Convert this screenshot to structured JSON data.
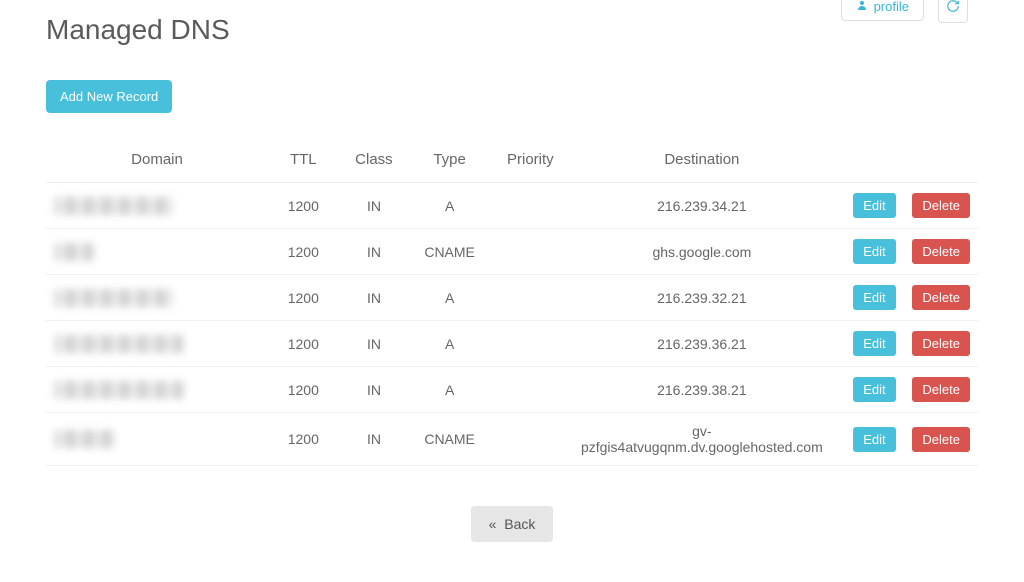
{
  "topbar": {
    "profile_label": "profile",
    "profile_icon": "user-icon",
    "refresh_icon": "refresh-icon"
  },
  "page_title": "Managed DNS",
  "buttons": {
    "add_record": "Add New Record",
    "edit": "Edit",
    "delete": "Delete",
    "back": "Back"
  },
  "columns": {
    "domain": "Domain",
    "ttl": "TTL",
    "class": "Class",
    "type": "Type",
    "priority": "Priority",
    "destination": "Destination"
  },
  "records": [
    {
      "domain_obscured": true,
      "ttl": "1200",
      "class": "IN",
      "type": "A",
      "priority": "",
      "destination": "216.239.34.21"
    },
    {
      "domain_obscured": true,
      "ttl": "1200",
      "class": "IN",
      "type": "CNAME",
      "priority": "",
      "destination": "ghs.google.com"
    },
    {
      "domain_obscured": true,
      "ttl": "1200",
      "class": "IN",
      "type": "A",
      "priority": "",
      "destination": "216.239.32.21"
    },
    {
      "domain_obscured": true,
      "ttl": "1200",
      "class": "IN",
      "type": "A",
      "priority": "",
      "destination": "216.239.36.21"
    },
    {
      "domain_obscured": true,
      "ttl": "1200",
      "class": "IN",
      "type": "A",
      "priority": "",
      "destination": "216.239.38.21"
    },
    {
      "domain_obscured": true,
      "ttl": "1200",
      "class": "IN",
      "type": "CNAME",
      "priority": "",
      "destination": "gv-pzfgis4atvugqnm.dv.googlehosted.com"
    }
  ],
  "blur_widths": [
    120,
    40,
    120,
    130,
    130,
    60
  ]
}
